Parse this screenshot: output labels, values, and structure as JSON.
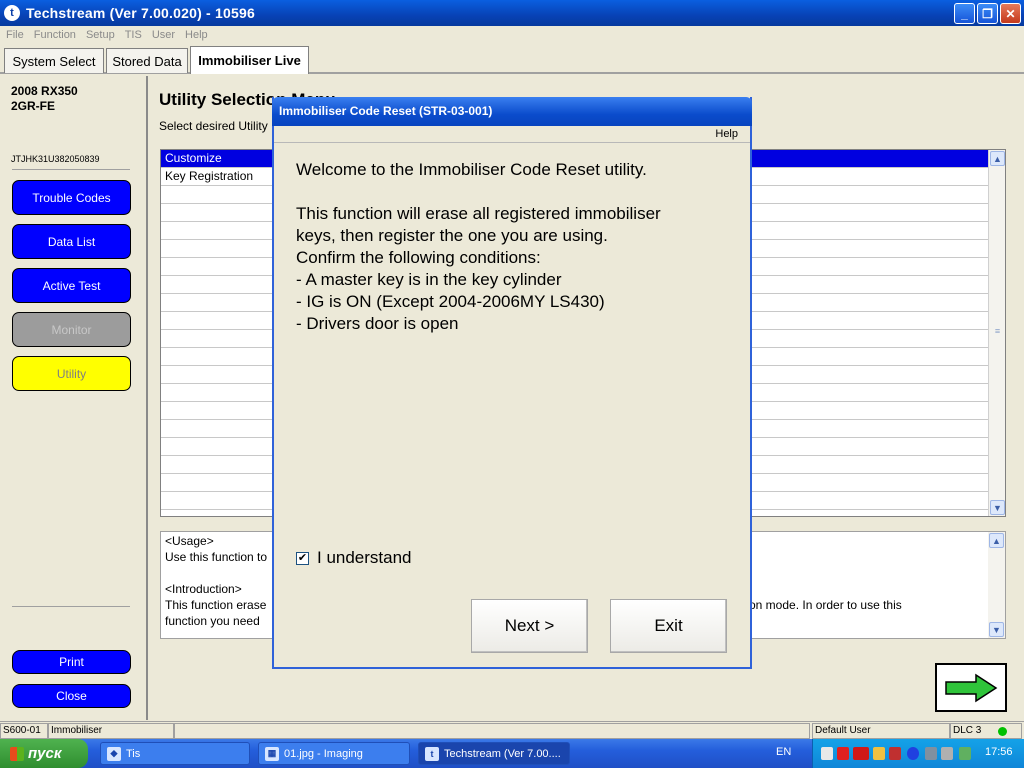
{
  "window": {
    "title": "Techstream (Ver 7.00.020) - 10596",
    "app_icon": "t",
    "controls": {
      "minimize": "_",
      "restore": "❐",
      "close": "✕"
    }
  },
  "menu": [
    "File",
    "Function",
    "Setup",
    "TIS",
    "User",
    "Help"
  ],
  "tabs": [
    {
      "label": "System Select"
    },
    {
      "label": "Stored Data"
    },
    {
      "label": "Immobiliser Live"
    }
  ],
  "left": {
    "vehicle_model": "2008 RX350",
    "vehicle_engine": "2GR-FE",
    "vin": "JTJHK31U382050839",
    "buttons": [
      "Trouble Codes",
      "Data List",
      "Active Test",
      "Monitor",
      "Utility"
    ],
    "print_label": "Print",
    "close_label": "Close"
  },
  "main": {
    "title": "Utility Selection Menu",
    "subtitle": "Select desired Utility",
    "list_items": [
      "Customize",
      "Key Registration"
    ],
    "desc_usage_head": "<Usage>",
    "desc_usage_text": "Use this function to",
    "desc_intro_head": "<Introduction>",
    "desc_intro_text_left": "This function erase",
    "desc_intro_text_right": "tration mode. In order to use this",
    "desc_line_3": "function you need"
  },
  "dialog": {
    "title": "Immobiliser Code Reset (STR-03-001)",
    "help": "Help",
    "lines": [
      "Welcome to the Immobiliser Code Reset utility.",
      "",
      "This function will erase all registered immobiliser",
      "keys, then register the one you are using.",
      "Confirm the following conditions:",
      "- A master key is in the key cylinder",
      "- IG is ON (Except 2004-2006MY LS430)",
      "- Drivers door is open"
    ],
    "checkbox_label": "I understand",
    "checkbox_checked": true,
    "next_label": "Next >",
    "exit_label": "Exit"
  },
  "status": {
    "code": "S600-01",
    "module": "Immobiliser",
    "user": "Default User",
    "dlc": "DLC 3"
  },
  "taskbar": {
    "start": "пуск",
    "tasks": [
      {
        "label": "Tis",
        "icon": "tis-icon"
      },
      {
        "label": "01.jpg - Imaging",
        "icon": "imaging-icon"
      },
      {
        "label": "Techstream (Ver 7.00....",
        "icon": "techstream-icon"
      }
    ],
    "lang": "EN",
    "time": "17:56"
  }
}
